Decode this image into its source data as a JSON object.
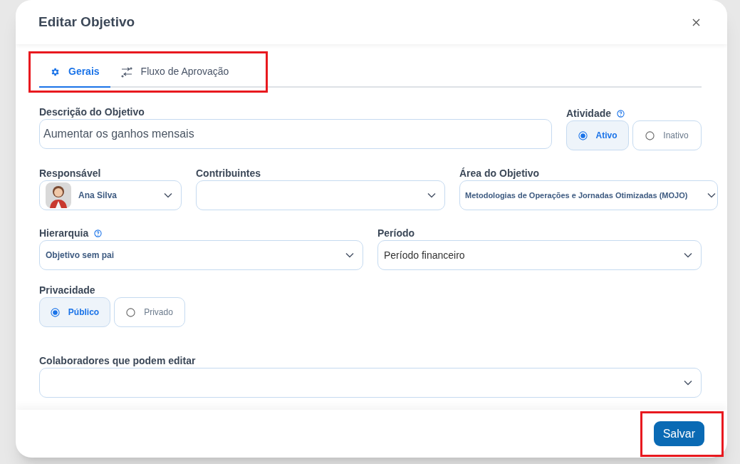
{
  "dialog": {
    "title": "Editar Objetivo"
  },
  "tabs": [
    {
      "label": "Gerais",
      "kind": "settings",
      "selected": true
    },
    {
      "label": "Fluxo de Aprovação",
      "kind": "flow",
      "selected": false
    }
  ],
  "description": {
    "label": "Descrição do Objetivo",
    "value": "Aumentar os ganhos mensais"
  },
  "activity": {
    "label": "Atividade",
    "options": [
      {
        "label": "Ativo",
        "selected": true
      },
      {
        "label": "Inativo",
        "selected": false
      }
    ]
  },
  "responsible": {
    "label": "Responsável",
    "value": "Ana Silva"
  },
  "contributors": {
    "label": "Contribuintes"
  },
  "area": {
    "label": "Área do Objetivo",
    "value": "Metodologias de Operações e Jornadas Otimizadas (MOJO)"
  },
  "hierarchy": {
    "label": "Hierarquia",
    "value": "Objetivo sem pai"
  },
  "period": {
    "label": "Período",
    "value": "Período financeiro"
  },
  "privacy": {
    "label": "Privacidade",
    "options": [
      {
        "label": "Público",
        "selected": true
      },
      {
        "label": "Privado",
        "selected": false
      }
    ]
  },
  "editors": {
    "label": "Colaboradores que podem editar"
  },
  "save_button": "Salvar",
  "highlights": {
    "tabs": true,
    "save_button": true
  }
}
